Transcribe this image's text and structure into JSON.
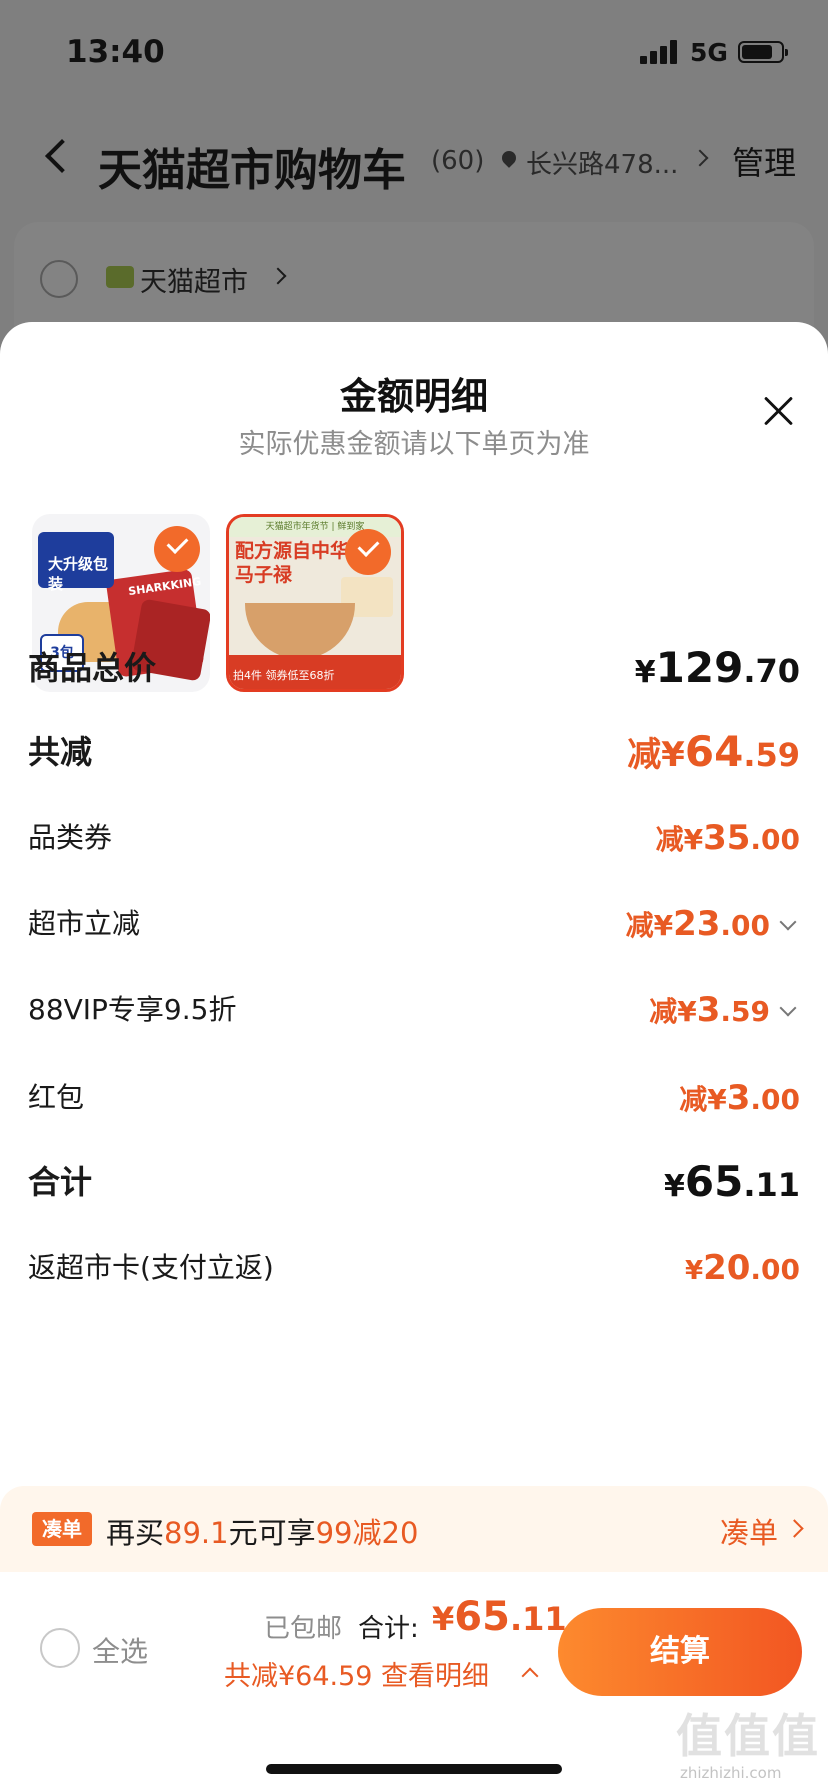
{
  "status_bar": {
    "time": "13:40",
    "network": "5G"
  },
  "header": {
    "title": "天猫超市购物车",
    "count": "(60)",
    "address": "长兴路478...",
    "manage_label": "管理"
  },
  "store": {
    "name": "天猫超市"
  },
  "sheet": {
    "title": "金额明细",
    "subtitle": "实际优惠金额请以下单页为准",
    "products": [
      {
        "brand": "SHARKKING",
        "headline": "大升级包装",
        "pack_count": "3包",
        "selected": true
      },
      {
        "banner": "天猫超市年货节 | 鲜到家",
        "headline": "配方源自中华马子禄",
        "strip_text": "拍4件 领券低至68折",
        "selected": true
      }
    ]
  },
  "amounts": {
    "goods_total": {
      "label": "商品总价",
      "prefix": "¥",
      "int": "129",
      "dec": ".70"
    },
    "total_discount": {
      "label": "共减",
      "prefix": "减¥",
      "int": "64",
      "dec": ".59"
    },
    "category_coupon": {
      "label": "品类券",
      "prefix": "减¥",
      "int": "35",
      "dec": ".00"
    },
    "supermarket_off": {
      "label": "超市立减",
      "prefix": "减¥",
      "int": "23",
      "dec": ".00"
    },
    "vip_discount": {
      "label": "88VIP专享9.5折",
      "prefix": "减¥",
      "int": "3",
      "dec": ".59"
    },
    "red_packet": {
      "label": "红包",
      "prefix": "减¥",
      "int": "3",
      "dec": ".00"
    },
    "subtotal": {
      "label": "合计",
      "prefix": "¥",
      "int": "65",
      "dec": ".11"
    },
    "cashback": {
      "label": "返超市卡(支付立返)",
      "prefix": "¥",
      "int": "20",
      "dec": ".00"
    }
  },
  "promo": {
    "tag": "凑单",
    "text_before": "再买",
    "amount": "89.1",
    "text_mid": "元可享",
    "offer": "99减20",
    "link": "凑单"
  },
  "footer": {
    "select_all": "全选",
    "shipping": "已包邮",
    "total_label": "合计:",
    "total_prefix": "¥",
    "total_int": "65",
    "total_dec": ".11",
    "discount_line": "共减¥64.59 查看明细",
    "checkout": "结算"
  },
  "watermark": {
    "text": "值值值",
    "sub": "zhizhizhi.com"
  },
  "colors": {
    "accent": "#e85a23",
    "button_start": "#fd8a2e",
    "button_end": "#f25622"
  }
}
